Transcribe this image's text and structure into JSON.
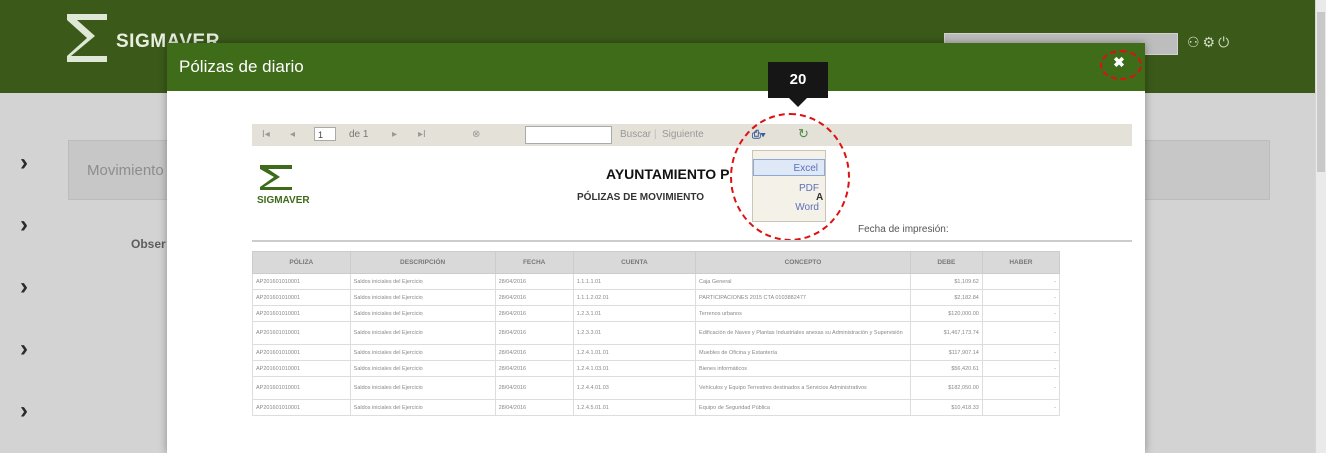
{
  "app": {
    "logo_text": "SIGMAVER",
    "background_label": "Movimiento",
    "background_field": "Obser",
    "colors": {
      "header_green": "#3b5a1a",
      "modal_green": "#3e6c18",
      "highlight_red": "#dd1111"
    }
  },
  "modal": {
    "title": "Pólizas de diario",
    "close_icon": "close-icon",
    "step_badge": "20",
    "toolbar": {
      "first": "I◂",
      "prev": "◂",
      "page_value": "1",
      "page_of": "de 1",
      "next": "▸",
      "last": "▸I",
      "stop": "⊗",
      "find_label": "Buscar",
      "next_label": "Siguiente"
    },
    "export_menu": {
      "options": [
        "Excel",
        "PDF",
        "Word"
      ]
    }
  },
  "report": {
    "logo_text": "SIGMAVER",
    "title": "AYUNTAMIENTO P",
    "subtitle_left": "PÓLIZAS DE MOVIMIENTO",
    "subtitle_right": "A",
    "date_label": "Fecha de impresión:",
    "columns": [
      "PÓLIZA",
      "DESCRIPCIÓN",
      "FECHA",
      "CUENTA",
      "CONCEPTO",
      "DEBE",
      "HABER"
    ],
    "rows": [
      [
        "AP201601010001",
        "Saldos iniciales del Ejercicio",
        "28/04/2016",
        "1.1.1.1.01",
        "Caja General",
        "$1,109.62",
        "-"
      ],
      [
        "AP201601010001",
        "Saldos iniciales del Ejercicio",
        "28/04/2016",
        "1.1.1.2.02.01",
        "PARTICIPACIONES 2015 CTA 0103882477",
        "$2,182.84",
        "-"
      ],
      [
        "AP201601010001",
        "Saldos iniciales del Ejercicio",
        "28/04/2016",
        "1.2.3.1.01",
        "Terrenos urbanos",
        "$120,000.00",
        "-"
      ],
      [
        "AP201601010001",
        "Saldos iniciales del Ejercicio",
        "28/04/2016",
        "1.2.3.3.01",
        "Edificación de Naves y Plantas Industriales anexas su Administración y Supervisión",
        "$1,467,173.74",
        "-"
      ],
      [
        "AP201601010001",
        "Saldos iniciales del Ejercicio",
        "28/04/2016",
        "1.2.4.1.01.01",
        "Muebles de Oficina y Estantería",
        "$117,907.14",
        "-"
      ],
      [
        "AP201601010001",
        "Saldos iniciales del Ejercicio",
        "28/04/2016",
        "1.2.4.1.03.01",
        "Bienes informáticos",
        "$56,420.61",
        "-"
      ],
      [
        "AP201601010001",
        "Saldos iniciales del Ejercicio",
        "28/04/2016",
        "1.2.4.4.01.03",
        "Vehículos y Equipo Terrestres destinados a Servicios Administrativos",
        "$182,050.00",
        "-"
      ],
      [
        "AP201601010001",
        "Saldos iniciales del Ejercicio",
        "28/04/2016",
        "1.2.4.5.01.01",
        "Equipo de Seguridad Pública",
        "$10,418.33",
        "-"
      ]
    ]
  }
}
